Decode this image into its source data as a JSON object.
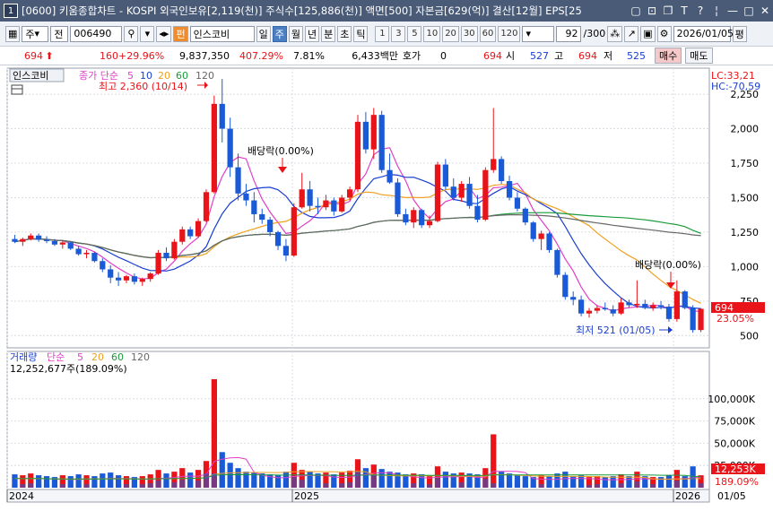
{
  "window": {
    "number": "1",
    "title": "[0600] 키움종합차트 - KOSPI 외국인보유[2,119(천)] 주식수[125,886(천)] 액면[500] 자본금[629(억)] 결산[12월] EPS[25"
  },
  "toolbar": {
    "market": "주",
    "market_kind": "전",
    "code": "006490",
    "name_tag": "펀",
    "stock_name": "인스코비",
    "periods": [
      "일",
      "주",
      "월",
      "년",
      "분",
      "초",
      "틱"
    ],
    "selected_period": "주",
    "intervals": [
      "1",
      "3",
      "5",
      "10",
      "20",
      "30",
      "60",
      "120"
    ],
    "count": "92",
    "count_total": "/300",
    "date": "2026/01/05",
    "last_btn": "평"
  },
  "quote": {
    "price": "694",
    "change": "160",
    "change_rate": "+29.96%",
    "volume": "9,837,350",
    "volume_rate": "407.29%",
    "turnover": "7.81%",
    "amount": "6,433백만",
    "hoga_label": "호가",
    "hoga_value": "0",
    "ask_value": "694",
    "open_label": "시",
    "open_value": "527",
    "high_label": "고",
    "high_value": "694",
    "low_label": "저",
    "low_value": "525",
    "buy_btn": "매수",
    "sell_btn": "매도"
  },
  "chart_data": [
    {
      "type": "candlestick",
      "stock_label": "인스코비",
      "legend": {
        "prefix": "종가 단순",
        "periods": [
          "5",
          "10",
          "20",
          "60",
          "120"
        ],
        "colors": [
          "#e040c8",
          "#1a3fd1",
          "#f0a020",
          "#1a9a3a",
          "#666666"
        ]
      },
      "y_ticks": [
        500,
        750,
        1000,
        1250,
        1500,
        1750,
        2000,
        2250
      ],
      "ylim": [
        450,
        2400
      ],
      "x_labels": [
        "2024",
        "2025",
        "2026"
      ],
      "lc_label": "LC:33,21",
      "hc_label": "HC:-70,59",
      "current_price": "694",
      "current_rate": "23.05%",
      "annotations": {
        "high": "최고 2,360 (10/14)",
        "low": "최저 521 (01/05)",
        "div1": "배당락(0.00%)",
        "div2": "배당락(0.00%)"
      },
      "candles": [
        [
          1200,
          1230,
          1170,
          1180
        ],
        [
          1180,
          1210,
          1150,
          1200
        ],
        [
          1200,
          1240,
          1190,
          1225
        ],
        [
          1225,
          1240,
          1180,
          1195
        ],
        [
          1195,
          1220,
          1170,
          1185
        ],
        [
          1185,
          1200,
          1150,
          1160
        ],
        [
          1160,
          1190,
          1130,
          1175
        ],
        [
          1175,
          1180,
          1120,
          1130
        ],
        [
          1130,
          1150,
          1080,
          1090
        ],
        [
          1090,
          1120,
          1060,
          1100
        ],
        [
          1100,
          1110,
          1030,
          1040
        ],
        [
          1040,
          1060,
          960,
          980
        ],
        [
          980,
          1010,
          880,
          920
        ],
        [
          920,
          960,
          860,
          900
        ],
        [
          900,
          940,
          880,
          930
        ],
        [
          930,
          950,
          870,
          890
        ],
        [
          890,
          920,
          860,
          910
        ],
        [
          910,
          960,
          890,
          950
        ],
        [
          950,
          1120,
          940,
          1100
        ],
        [
          1100,
          1140,
          1040,
          1060
        ],
        [
          1060,
          1200,
          1050,
          1180
        ],
        [
          1180,
          1290,
          1160,
          1270
        ],
        [
          1270,
          1290,
          1200,
          1220
        ],
        [
          1220,
          1350,
          1210,
          1330
        ],
        [
          1330,
          1560,
          1320,
          1540
        ],
        [
          1540,
          2240,
          1530,
          2180
        ],
        [
          2180,
          2360,
          1900,
          2000
        ],
        [
          2000,
          2080,
          1650,
          1720
        ],
        [
          1720,
          1820,
          1480,
          1530
        ],
        [
          1530,
          1600,
          1440,
          1480
        ],
        [
          1480,
          1540,
          1320,
          1380
        ],
        [
          1380,
          1420,
          1310,
          1340
        ],
        [
          1340,
          1360,
          1220,
          1250
        ],
        [
          1250,
          1260,
          1120,
          1150
        ],
        [
          1150,
          1200,
          1040,
          1080
        ],
        [
          1080,
          1460,
          1070,
          1430
        ],
        [
          1430,
          1680,
          1420,
          1560
        ],
        [
          1560,
          1620,
          1400,
          1440
        ],
        [
          1440,
          1500,
          1380,
          1430
        ],
        [
          1430,
          1520,
          1410,
          1480
        ],
        [
          1480,
          1500,
          1370,
          1400
        ],
        [
          1400,
          1520,
          1390,
          1500
        ],
        [
          1500,
          1580,
          1480,
          1560
        ],
        [
          1560,
          2100,
          1540,
          2050
        ],
        [
          2050,
          2120,
          1820,
          1850
        ],
        [
          1850,
          2150,
          1780,
          2100
        ],
        [
          2100,
          2130,
          1680,
          1700
        ],
        [
          1700,
          1820,
          1600,
          1610
        ],
        [
          1610,
          1640,
          1360,
          1380
        ],
        [
          1380,
          1420,
          1300,
          1320
        ],
        [
          1320,
          1430,
          1280,
          1410
        ],
        [
          1410,
          1420,
          1280,
          1300
        ],
        [
          1300,
          1370,
          1280,
          1330
        ],
        [
          1330,
          1760,
          1320,
          1740
        ],
        [
          1740,
          1780,
          1560,
          1580
        ],
        [
          1580,
          1640,
          1480,
          1500
        ],
        [
          1500,
          1620,
          1470,
          1600
        ],
        [
          1600,
          1650,
          1420,
          1440
        ],
        [
          1440,
          1520,
          1320,
          1340
        ],
        [
          1340,
          1720,
          1330,
          1700
        ],
        [
          1700,
          2150,
          1680,
          1780
        ],
        [
          1780,
          1800,
          1600,
          1620
        ],
        [
          1620,
          1660,
          1480,
          1500
        ],
        [
          1500,
          1540,
          1400,
          1420
        ],
        [
          1420,
          1430,
          1300,
          1320
        ],
        [
          1320,
          1330,
          1180,
          1200
        ],
        [
          1200,
          1260,
          1120,
          1240
        ],
        [
          1240,
          1250,
          1100,
          1120
        ],
        [
          1120,
          1130,
          920,
          940
        ],
        [
          940,
          960,
          760,
          780
        ],
        [
          780,
          820,
          720,
          760
        ],
        [
          760,
          790,
          640,
          660
        ],
        [
          660,
          700,
          630,
          680
        ],
        [
          680,
          720,
          660,
          700
        ],
        [
          700,
          740,
          680,
          690
        ],
        [
          690,
          720,
          640,
          660
        ],
        [
          660,
          770,
          650,
          740
        ],
        [
          740,
          760,
          700,
          720
        ],
        [
          720,
          900,
          700,
          730
        ],
        [
          730,
          760,
          690,
          700
        ],
        [
          700,
          740,
          680,
          720
        ],
        [
          720,
          750,
          690,
          710
        ],
        [
          710,
          730,
          600,
          620
        ],
        [
          620,
          900,
          600,
          820
        ],
        [
          820,
          830,
          690,
          700
        ],
        [
          700,
          720,
          521,
          540
        ],
        [
          540,
          700,
          525,
          694
        ]
      ],
      "volumes": [
        15,
        14,
        16,
        14,
        13,
        12,
        14,
        13,
        15,
        14,
        13,
        16,
        17,
        14,
        13,
        12,
        13,
        15,
        20,
        16,
        18,
        22,
        17,
        20,
        30,
        122,
        40,
        28,
        22,
        18,
        17,
        16,
        15,
        14,
        18,
        28,
        20,
        18,
        16,
        17,
        15,
        17,
        19,
        32,
        22,
        26,
        21,
        18,
        17,
        15,
        16,
        15,
        14,
        24,
        18,
        16,
        17,
        16,
        15,
        22,
        60,
        18,
        16,
        14,
        13,
        12,
        14,
        13,
        16,
        18,
        13,
        14,
        12,
        13,
        12,
        13,
        15,
        13,
        18,
        13,
        12,
        12,
        14,
        20,
        13,
        24,
        14
      ],
      "volume_overlay": [
        4,
        4,
        5,
        4,
        4,
        3,
        4,
        4,
        5,
        4,
        4,
        5,
        6,
        4,
        4,
        3,
        4,
        5,
        8,
        7,
        6,
        9,
        7,
        8,
        16,
        16,
        14,
        12,
        10,
        8,
        7,
        6,
        5,
        4,
        6,
        12,
        9,
        8,
        6,
        5,
        4,
        5,
        6,
        18,
        12,
        14,
        10,
        8,
        7,
        5,
        5,
        4,
        4,
        11,
        7,
        6,
        6,
        6,
        5,
        10,
        5,
        6,
        6,
        5,
        4,
        3,
        4,
        3,
        5,
        6,
        4,
        4,
        3,
        4,
        3,
        4,
        5,
        4,
        7,
        4,
        4,
        4,
        5,
        8,
        4,
        12,
        5
      ],
      "vol_label": "거래량",
      "vol_legend_prefix": "단순",
      "vol_legend_periods": [
        "5",
        "20",
        "60",
        "120"
      ],
      "vol_info": "12,252,677주(189.09%)",
      "vol_ticks": [
        "100,000K",
        "75,000K",
        "50,000K",
        "25,000K"
      ],
      "vol_ylim": [
        0,
        125
      ],
      "vol_current": "12,253K",
      "vol_current_rate": "189.09%",
      "x_date_right": "01/05"
    }
  ]
}
